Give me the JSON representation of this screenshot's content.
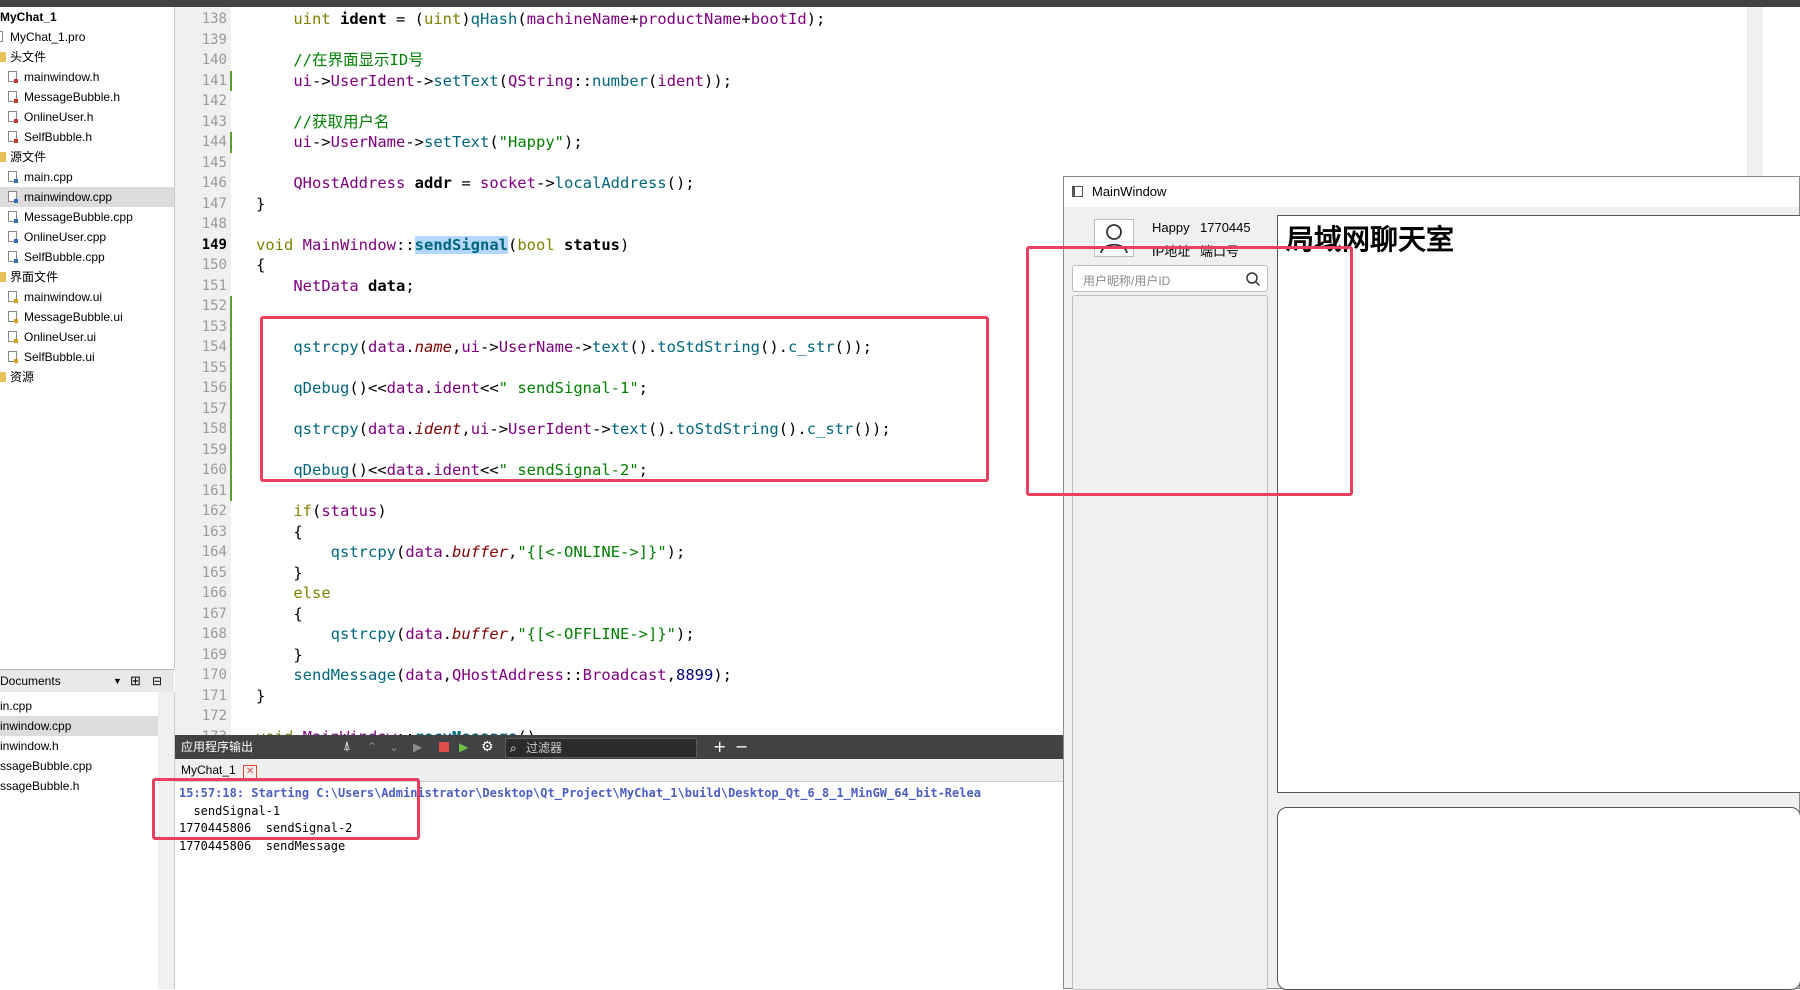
{
  "project_tree": {
    "items": [
      {
        "label": "MyChat_1",
        "indent": 0,
        "kind": "project"
      },
      {
        "label": "MyChat_1.pro",
        "indent": 1,
        "kind": "pro"
      },
      {
        "label": "头文件",
        "indent": 1,
        "kind": "folder"
      },
      {
        "label": "mainwindow.h",
        "indent": 2,
        "kind": "h"
      },
      {
        "label": "MessageBubble.h",
        "indent": 2,
        "kind": "h"
      },
      {
        "label": "OnlineUser.h",
        "indent": 2,
        "kind": "h"
      },
      {
        "label": "SelfBubble.h",
        "indent": 2,
        "kind": "h"
      },
      {
        "label": "源文件",
        "indent": 1,
        "kind": "folder"
      },
      {
        "label": "main.cpp",
        "indent": 2,
        "kind": "cpp"
      },
      {
        "label": "mainwindow.cpp",
        "indent": 2,
        "kind": "cpp",
        "selected": true
      },
      {
        "label": "MessageBubble.cpp",
        "indent": 2,
        "kind": "cpp"
      },
      {
        "label": "OnlineUser.cpp",
        "indent": 2,
        "kind": "cpp"
      },
      {
        "label": "SelfBubble.cpp",
        "indent": 2,
        "kind": "cpp"
      },
      {
        "label": "界面文件",
        "indent": 1,
        "kind": "folder"
      },
      {
        "label": "mainwindow.ui",
        "indent": 2,
        "kind": "ui"
      },
      {
        "label": "MessageBubble.ui",
        "indent": 2,
        "kind": "ui"
      },
      {
        "label": "OnlineUser.ui",
        "indent": 2,
        "kind": "ui"
      },
      {
        "label": "SelfBubble.ui",
        "indent": 2,
        "kind": "ui"
      },
      {
        "label": "资源",
        "indent": 1,
        "kind": "folder"
      }
    ]
  },
  "open_documents": {
    "header": "Documents",
    "items": [
      {
        "label": "in.cpp"
      },
      {
        "label": "inwindow.cpp",
        "selected": true
      },
      {
        "label": "inwindow.h"
      },
      {
        "label": "ssageBubble.cpp"
      },
      {
        "label": "ssageBubble.h"
      }
    ]
  },
  "editor": {
    "current_line": "149",
    "lines": [
      {
        "n": "138",
        "html": "    <span class='kw'>uint</span> <span class='bold'>ident</span> = (<span class='kw'>uint</span>)<span class='fn'>qHash</span>(<span class='ty'>machineName</span>+<span class='ty'>productName</span>+<span class='ty'>bootId</span>);"
      },
      {
        "n": "139",
        "html": ""
      },
      {
        "n": "140",
        "html": "    <span class='cm'>//在界面显示ID号</span>"
      },
      {
        "n": "141",
        "html": "    <span class='ty'>ui</span>-><span class='ty'>UserIdent</span>-><span class='fn'>setText</span>(<span class='ty'>QString</span>::<span class='fn'>number</span>(<span class='ty'>ident</span>));"
      },
      {
        "n": "142",
        "html": ""
      },
      {
        "n": "143",
        "html": "    <span class='cm'>//获取用户名</span>"
      },
      {
        "n": "144",
        "html": "    <span class='ty'>ui</span>-><span class='ty'>UserName</span>-><span class='fn'>setText</span>(<span class='st'>\"Happy\"</span>);"
      },
      {
        "n": "145",
        "html": ""
      },
      {
        "n": "146",
        "html": "    <span class='ty'>QHostAddress</span> <span class='bold'>addr</span> = <span class='ty'>socket</span>-><span class='fn'>localAddress</span>();"
      },
      {
        "n": "147",
        "html": "}"
      },
      {
        "n": "148",
        "html": ""
      },
      {
        "n": "149",
        "html": "<span class='kw'>void</span> <span class='ty'>MainWindow</span>::<span class='bold fn hl'>sendSignal</span>(<span class='kw'>bool</span> <span class='bold'>status</span>)"
      },
      {
        "n": "150",
        "html": "{"
      },
      {
        "n": "151",
        "html": "    <span class='ty'>NetData</span> <span class='bold'>data</span>;"
      },
      {
        "n": "152",
        "html": ""
      },
      {
        "n": "153",
        "html": ""
      },
      {
        "n": "154",
        "html": "    <span class='fn'>qstrcpy</span>(<span class='ty'>data</span>.<span class='it'>name</span>,<span class='ty'>ui</span>-><span class='ty'>UserName</span>-><span class='fn'>text</span>().<span class='fn'>toStdString</span>().<span class='fn'>c_str</span>());"
      },
      {
        "n": "155",
        "html": ""
      },
      {
        "n": "156",
        "html": "    <span class='fn'>qDebug</span>()<<<span class='ty'>data</span>.<span class='ty'>ident</span><<<span class='st'>\" sendSignal-1\"</span>;"
      },
      {
        "n": "157",
        "html": ""
      },
      {
        "n": "158",
        "html": "    <span class='fn'>qstrcpy</span>(<span class='ty'>data</span>.<span class='it'>ident</span>,<span class='ty'>ui</span>-><span class='ty'>UserIdent</span>-><span class='fn'>text</span>().<span class='fn'>toStdString</span>().<span class='fn'>c_str</span>());"
      },
      {
        "n": "159",
        "html": ""
      },
      {
        "n": "160",
        "html": "    <span class='fn'>qDebug</span>()<<<span class='ty'>data</span>.<span class='ty'>ident</span><<<span class='st'>\" sendSignal-2\"</span>;"
      },
      {
        "n": "161",
        "html": ""
      },
      {
        "n": "162",
        "html": "    <span class='kw'>if</span>(<span class='ty'>status</span>)"
      },
      {
        "n": "163",
        "html": "    {"
      },
      {
        "n": "164",
        "html": "        <span class='fn'>qstrcpy</span>(<span class='ty'>data</span>.<span class='it'>buffer</span>,<span class='st'>\"{[<-ONLINE->]}\"</span>);"
      },
      {
        "n": "165",
        "html": "    }"
      },
      {
        "n": "166",
        "html": "    <span class='kw'>else</span>"
      },
      {
        "n": "167",
        "html": "    {"
      },
      {
        "n": "168",
        "html": "        <span class='fn'>qstrcpy</span>(<span class='ty'>data</span>.<span class='it'>buffer</span>,<span class='st'>\"{[<-OFFLINE->]}\"</span>);"
      },
      {
        "n": "169",
        "html": "    }"
      },
      {
        "n": "170",
        "html": "    <span class='fn'>sendMessage</span>(<span class='ty'>data</span>,<span class='ty'>QHostAddress</span>::<span class='ty'>Broadcast</span>,<span class='nm'>8899</span>);"
      },
      {
        "n": "171",
        "html": "}"
      },
      {
        "n": "172",
        "html": ""
      },
      {
        "n": "173",
        "html": "<span class='kw'>void</span> <span class='ty'>MainWindow</span>::<span class='bold fn'>recvMessage</span>()"
      }
    ]
  },
  "output": {
    "title": "应用程序输出",
    "filter_placeholder": "过滤器",
    "tab_label": "MyChat_1",
    "lines": [
      {
        "text": "15:57:18: Starting C:\\Users\\Administrator\\Desktop\\Qt_Project\\MyChat_1\\build\\Desktop_Qt_6_8_1_MinGW_64_bit-Relea",
        "style": "start"
      },
      {
        "text": "  sendSignal-1",
        "style": "normal"
      },
      {
        "text": "1770445806  sendSignal-2",
        "style": "normal"
      },
      {
        "text": "1770445806  sendMessage",
        "style": "normal"
      }
    ]
  },
  "app_window": {
    "title": "MainWindow",
    "user_name": "Happy",
    "user_ident": "1770445",
    "ip_label": "IP地址",
    "port_label": "端口号",
    "search_placeholder": "用户昵称/用户ID",
    "chat_title": "局域网聊天室"
  },
  "colors": {
    "annotation_red": "#e8405f",
    "selection": "#dcdcdc",
    "output_header": "#404244",
    "log_start_blue": "#4a5ec4"
  }
}
